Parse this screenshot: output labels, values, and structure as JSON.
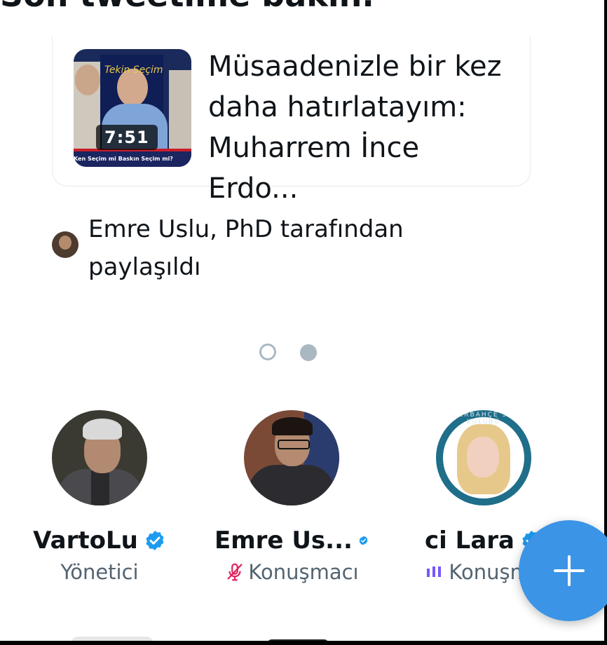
{
  "header": {
    "title": "Son tweetime bakın."
  },
  "tweet_card": {
    "duration": "7:51",
    "thumbnail_caption": "Ken Seçim mi Baskın Seçim mi?",
    "thumbnail_overlay": "Tekin Seçim",
    "text": "Müsaadenizle bir kez daha hatırlatayım: Muharrem İnce Erdo..."
  },
  "shared_by": {
    "text": "Emre Uslu, PhD tarafından paylaşıldı"
  },
  "pagination": {
    "total": 2,
    "active": 2
  },
  "participants": [
    {
      "name": "VartoLu",
      "role": "Yönetici",
      "verified": true,
      "role_icon": ""
    },
    {
      "name": "Emre Us...",
      "role": "Konuşmacı",
      "verified": true,
      "role_icon": "muted-mic-icon"
    },
    {
      "name": "ci Lara",
      "role": "Konuşma",
      "verified": true,
      "role_icon": "speaking-bars-icon"
    }
  ],
  "avatar_ring_text": "FENERBAHÇE SPOR KULÜBÜ",
  "fab": {
    "icon": "plus-icon"
  },
  "colors": {
    "accent": "#1d9bf0",
    "fab": "#3b94e6",
    "muted_mic": "#e0245e",
    "speaking_bars": "#7856ff",
    "secondary_text": "#536471"
  }
}
